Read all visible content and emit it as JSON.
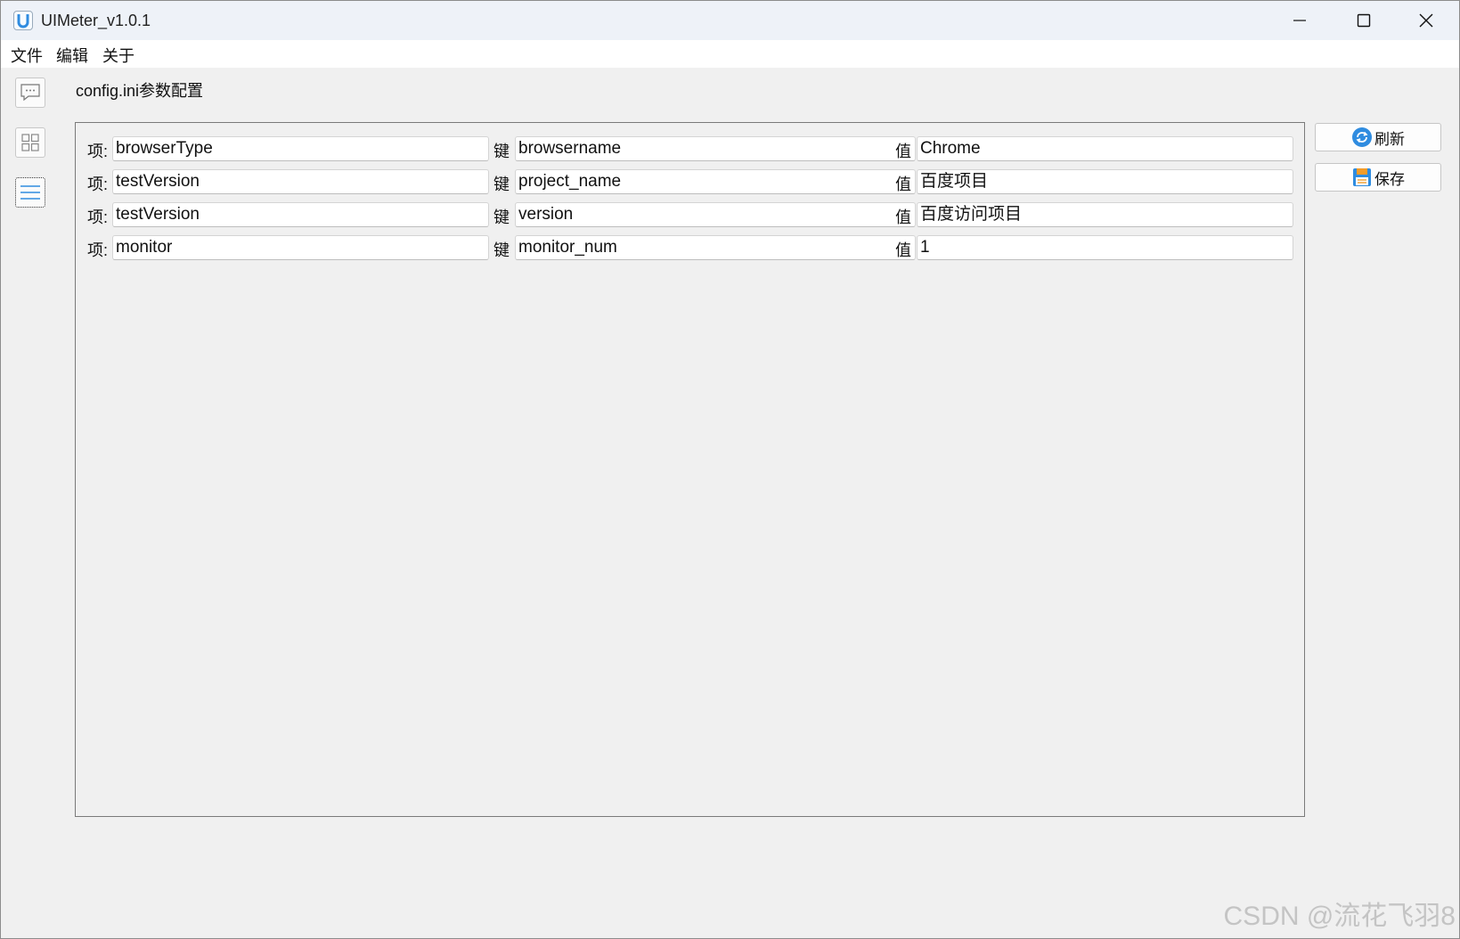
{
  "window": {
    "title": "UIMeter_v1.0.1",
    "accent": "#2f8ce0"
  },
  "menu": [
    {
      "label": "文件"
    },
    {
      "label": "编辑"
    },
    {
      "label": "关于"
    }
  ],
  "sidebar": {
    "items": [
      {
        "icon": "chat-bubble-icon",
        "active": false
      },
      {
        "icon": "grid-icon",
        "active": false
      },
      {
        "icon": "list-icon",
        "active": true
      }
    ]
  },
  "page": {
    "title": "config.ini参数配置"
  },
  "labels": {
    "section": "项:",
    "key": "键",
    "value": "值"
  },
  "rows": [
    {
      "section": "browserType",
      "key": "browsername",
      "value": "Chrome"
    },
    {
      "section": "testVersion",
      "key": "project_name",
      "value": "百度项目"
    },
    {
      "section": "testVersion",
      "key": "version",
      "value": "百度访问项目"
    },
    {
      "section": "monitor",
      "key": "monitor_num",
      "value": "1"
    }
  ],
  "actions": {
    "refresh": {
      "label": "刷新",
      "icon": "refresh-icon"
    },
    "save": {
      "label": "保存",
      "icon": "save-icon"
    }
  },
  "watermark": "CSDN @流花飞羽8"
}
